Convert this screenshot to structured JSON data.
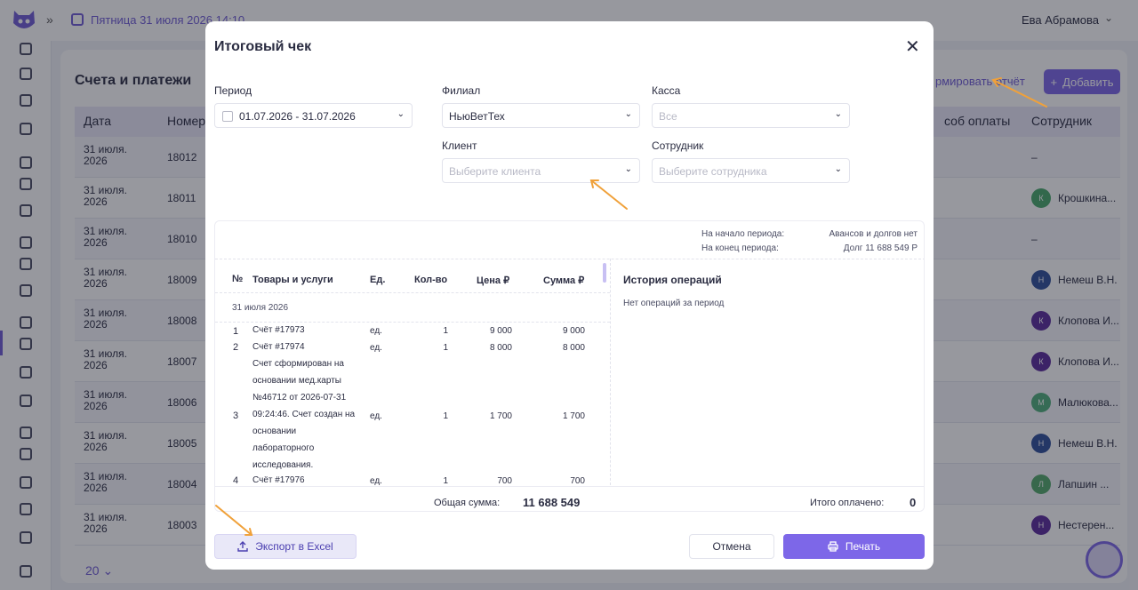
{
  "topbar": {
    "collapse_icon": "»",
    "date": "Пятница 31 июля 2026 14:10",
    "user": "Ева Абрамова",
    "user_chevron": "⌄"
  },
  "page": {
    "title": "Счета и платежи",
    "report_link": "рмировать отчёт",
    "add_button": "Добавить",
    "add_plus": "+",
    "columns": {
      "date": "Дата",
      "number": "Номер",
      "payment": "соб оплаты",
      "employee": "Сотрудник"
    },
    "rows": [
      {
        "date": "31 июля. 2026",
        "number": "18012",
        "employee": "–",
        "avatar": ""
      },
      {
        "date": "31 июля. 2026",
        "number": "18011",
        "employee": "Крошкина...",
        "avatar": "К"
      },
      {
        "date": "31 июля. 2026",
        "number": "18010",
        "employee": "–",
        "avatar": ""
      },
      {
        "date": "31 июля. 2026",
        "number": "18009",
        "employee": "Немеш В.Н.",
        "avatar": "Н"
      },
      {
        "date": "31 июля. 2026",
        "number": "18008",
        "employee": "Клопова И...",
        "avatar": "К"
      },
      {
        "date": "31 июля. 2026",
        "number": "18007",
        "employee": "Клопова И...",
        "avatar": "К"
      },
      {
        "date": "31 июля. 2026",
        "number": "18006",
        "employee": "Малюкова...",
        "avatar": "М"
      },
      {
        "date": "31 июля. 2026",
        "number": "18005",
        "employee": "Немеш В.Н.",
        "avatar": "Н"
      },
      {
        "date": "31 июля. 2026",
        "number": "18004",
        "employee": "Лапшин ...",
        "avatar": "Л"
      },
      {
        "date": "31 июля. 2026",
        "number": "18003",
        "employee": "Нестерен...",
        "avatar": "Н"
      }
    ],
    "pager": "20 ⌄"
  },
  "colors": {
    "accent": "#7d67e8",
    "avatar_K_green": "#47a86b",
    "avatar_N_blue": "#2f4f9a",
    "avatar_K_purple": "#5a2b9c",
    "avatar_M_green": "#4fae7a",
    "avatar_L_green": "#52a86a",
    "avatar_N_purple": "#5a2b9c"
  },
  "modal": {
    "title": "Итоговый чек",
    "close": "✕",
    "period_label": "Период",
    "period_value": "01.07.2026 - 31.07.2026",
    "branch_label": "Филиал",
    "branch_value": "НьюВетТех",
    "cash_label": "Касса",
    "cash_value": "Все",
    "client_label": "Клиент",
    "client_placeholder": "Выберите клиента",
    "employee_label": "Сотрудник",
    "employee_placeholder": "Выберите сотрудника",
    "chevron": "⌄",
    "summary": {
      "start_label": "На начало периода:",
      "start_value": "Авансов и долгов нет",
      "end_label": "На конец периода:",
      "end_value": "Долг 11 688 549 Р"
    },
    "table": {
      "headers": {
        "n": "№",
        "name": "Товары и услуги",
        "unit": "Ед.",
        "qty": "Кол-во",
        "price": "Цена ₽",
        "sum": "Сумма ₽"
      },
      "day": "31 июля 2026",
      "rows": [
        {
          "n": "1",
          "name": "Счёт #17973",
          "unit": "ед.",
          "qty": "1",
          "price": "9 000",
          "sum": "9 000"
        },
        {
          "n": "2",
          "name": "Счёт #17974",
          "unit": "ед.",
          "qty": "1",
          "price": "8 000",
          "sum": "8 000"
        },
        {
          "n": "3",
          "name": "Счет сформирован на основании мед.карты №46712 от 2026-07-31 09:24:46. Счет создан на основании лабораторного исследования.",
          "unit": "ед.",
          "qty": "1",
          "price": "1 700",
          "sum": "1 700"
        },
        {
          "n": "4",
          "name": "Счёт #17976",
          "unit": "ед.",
          "qty": "1",
          "price": "700",
          "sum": "700"
        }
      ]
    },
    "history_title": "История операций",
    "history_empty": "Нет операций за период",
    "total_label": "Общая сумма:",
    "total_value": "11 688 549",
    "paid_label": "Итого оплачено:",
    "paid_value": "0",
    "export_button": "Экспорт в Excel",
    "cancel_button": "Отмена",
    "print_button": "Печать"
  }
}
